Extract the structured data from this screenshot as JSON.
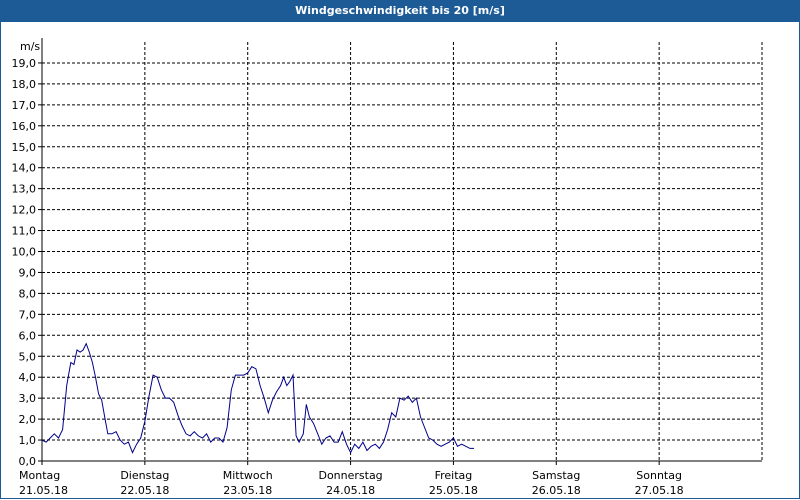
{
  "title": "Windgeschwindigkeit bis 20 [m/s]",
  "colors": {
    "titlebar": "#1d5b97",
    "line": "#00008b",
    "grid": "#000000"
  },
  "chart_data": {
    "type": "line",
    "title": "Windgeschwindigkeit bis 20 [m/s]",
    "ylabel": "m/s",
    "xlabel": "",
    "ylim": [
      0,
      20
    ],
    "xlim": [
      0,
      7
    ],
    "grid": true,
    "yticks": [
      "0,0",
      "1,0",
      "2,0",
      "3,0",
      "4,0",
      "5,0",
      "6,0",
      "7,0",
      "8,0",
      "9,0",
      "10,0",
      "11,0",
      "12,0",
      "13,0",
      "14,0",
      "15,0",
      "16,0",
      "17,0",
      "18,0",
      "19,0"
    ],
    "xticks": [
      {
        "day": "Montag",
        "date": "21.05.18"
      },
      {
        "day": "Dienstag",
        "date": "22.05.18"
      },
      {
        "day": "Mittwoch",
        "date": "23.05.18"
      },
      {
        "day": "Donnerstag",
        "date": "24.05.18"
      },
      {
        "day": "Freitag",
        "date": "25.05.18"
      },
      {
        "day": "Samstag",
        "date": "26.05.18"
      },
      {
        "day": "Sonntag",
        "date": "27.05.18"
      }
    ],
    "series": [
      {
        "points": [
          [
            0.0,
            1.0
          ],
          [
            0.04,
            0.9
          ],
          [
            0.08,
            1.1
          ],
          [
            0.12,
            1.3
          ],
          [
            0.16,
            1.1
          ],
          [
            0.2,
            1.5
          ],
          [
            0.24,
            3.6
          ],
          [
            0.28,
            4.7
          ],
          [
            0.31,
            4.6
          ],
          [
            0.34,
            5.3
          ],
          [
            0.37,
            5.2
          ],
          [
            0.4,
            5.3
          ],
          [
            0.43,
            5.6
          ],
          [
            0.46,
            5.2
          ],
          [
            0.49,
            4.7
          ],
          [
            0.52,
            4.0
          ],
          [
            0.55,
            3.2
          ],
          [
            0.58,
            2.9
          ],
          [
            0.61,
            2.1
          ],
          [
            0.64,
            1.3
          ],
          [
            0.68,
            1.3
          ],
          [
            0.72,
            1.4
          ],
          [
            0.76,
            1.0
          ],
          [
            0.8,
            0.8
          ],
          [
            0.84,
            0.9
          ],
          [
            0.88,
            0.4
          ],
          [
            0.92,
            0.8
          ],
          [
            0.96,
            1.1
          ],
          [
            1.0,
            1.9
          ],
          [
            1.04,
            3.1
          ],
          [
            1.08,
            4.1
          ],
          [
            1.12,
            4.0
          ],
          [
            1.16,
            3.4
          ],
          [
            1.2,
            3.0
          ],
          [
            1.24,
            3.0
          ],
          [
            1.28,
            2.8
          ],
          [
            1.32,
            2.2
          ],
          [
            1.36,
            1.7
          ],
          [
            1.4,
            1.3
          ],
          [
            1.44,
            1.2
          ],
          [
            1.48,
            1.4
          ],
          [
            1.52,
            1.2
          ],
          [
            1.56,
            1.1
          ],
          [
            1.6,
            1.3
          ],
          [
            1.64,
            0.9
          ],
          [
            1.68,
            1.1
          ],
          [
            1.72,
            1.1
          ],
          [
            1.76,
            0.9
          ],
          [
            1.8,
            1.6
          ],
          [
            1.84,
            3.4
          ],
          [
            1.88,
            4.1
          ],
          [
            1.92,
            4.1
          ],
          [
            1.96,
            4.1
          ],
          [
            2.0,
            4.2
          ],
          [
            2.04,
            4.5
          ],
          [
            2.08,
            4.4
          ],
          [
            2.12,
            3.6
          ],
          [
            2.16,
            3.0
          ],
          [
            2.2,
            2.3
          ],
          [
            2.24,
            2.9
          ],
          [
            2.28,
            3.3
          ],
          [
            2.32,
            3.6
          ],
          [
            2.35,
            4.0
          ],
          [
            2.38,
            3.6
          ],
          [
            2.41,
            3.8
          ],
          [
            2.44,
            4.1
          ],
          [
            2.47,
            1.2
          ],
          [
            2.5,
            0.9
          ],
          [
            2.54,
            1.3
          ],
          [
            2.57,
            2.7
          ],
          [
            2.6,
            2.1
          ],
          [
            2.64,
            1.8
          ],
          [
            2.68,
            1.3
          ],
          [
            2.72,
            0.8
          ],
          [
            2.76,
            1.1
          ],
          [
            2.8,
            1.2
          ],
          [
            2.84,
            0.9
          ],
          [
            2.88,
            0.9
          ],
          [
            2.92,
            1.4
          ],
          [
            2.96,
            0.8
          ],
          [
            3.0,
            0.4
          ],
          [
            3.04,
            0.8
          ],
          [
            3.08,
            0.6
          ],
          [
            3.12,
            0.9
          ],
          [
            3.16,
            0.5
          ],
          [
            3.2,
            0.7
          ],
          [
            3.24,
            0.8
          ],
          [
            3.28,
            0.6
          ],
          [
            3.32,
            0.9
          ],
          [
            3.36,
            1.5
          ],
          [
            3.4,
            2.3
          ],
          [
            3.44,
            2.1
          ],
          [
            3.48,
            3.0
          ],
          [
            3.52,
            2.9
          ],
          [
            3.56,
            3.1
          ],
          [
            3.6,
            2.8
          ],
          [
            3.64,
            3.0
          ],
          [
            3.68,
            2.1
          ],
          [
            3.72,
            1.6
          ],
          [
            3.76,
            1.1
          ],
          [
            3.8,
            1.0
          ],
          [
            3.84,
            0.8
          ],
          [
            3.88,
            0.7
          ],
          [
            3.92,
            0.8
          ],
          [
            3.96,
            0.9
          ],
          [
            4.0,
            1.1
          ],
          [
            4.04,
            0.7
          ],
          [
            4.08,
            0.8
          ],
          [
            4.12,
            0.7
          ],
          [
            4.16,
            0.6
          ],
          [
            4.2,
            0.6
          ]
        ]
      }
    ]
  }
}
